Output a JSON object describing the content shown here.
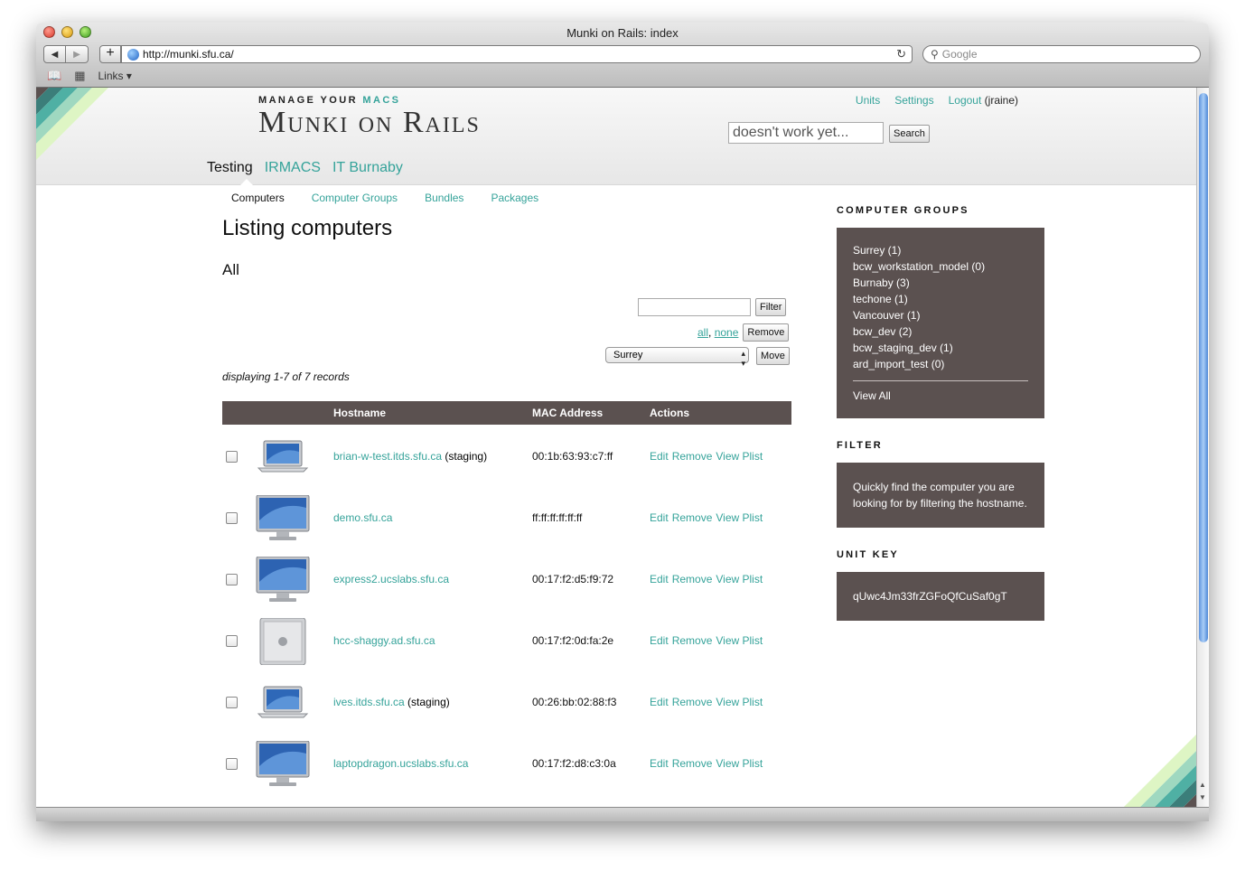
{
  "browser": {
    "window_title": "Munki on Rails: index",
    "url": "http://munki.sfu.ca/",
    "search_placeholder": "Google",
    "bookmarks_label": "Links"
  },
  "header": {
    "tagline_prefix": "MANAGE YOUR",
    "tagline_accent": "MACS",
    "logo": "Munki on Rails",
    "links": {
      "units": "Units",
      "settings": "Settings",
      "logout": "Logout",
      "user": "(jraine)"
    },
    "search_value": "doesn't work yet...",
    "search_button": "Search",
    "unit_tabs": [
      {
        "label": "Testing",
        "active": true
      },
      {
        "label": "IRMACS",
        "active": false
      },
      {
        "label": "IT Burnaby",
        "active": false
      }
    ]
  },
  "subnav": {
    "computers": "Computers",
    "computer_groups": "Computer Groups",
    "bundles": "Bundles",
    "packages": "Packages"
  },
  "main": {
    "title": "Listing computers",
    "subtitle": "All",
    "filter_button": "Filter",
    "select_all": "all",
    "select_none": "none",
    "remove_button": "Remove",
    "group_select": "Surrey",
    "move_button": "Move",
    "records": "displaying 1-7 of 7 records"
  },
  "table": {
    "columns": {
      "hostname": "Hostname",
      "mac": "MAC Address",
      "actions": "Actions"
    },
    "action_labels": {
      "edit": "Edit",
      "remove": "Remove",
      "view": "View Plist"
    },
    "rows": [
      {
        "host": "brian-w-test.itds.sfu.ca",
        "note": "(staging)",
        "mac": "00:1b:63:93:c7:ff",
        "icon": "macbook-icon"
      },
      {
        "host": "demo.sfu.ca",
        "note": "",
        "mac": "ff:ff:ff:ff:ff:ff",
        "icon": "imac-icon"
      },
      {
        "host": "express2.ucslabs.sfu.ca",
        "note": "",
        "mac": "00:17:f2:d5:f9:72",
        "icon": "imac-icon"
      },
      {
        "host": "hcc-shaggy.ad.sfu.ca",
        "note": "",
        "mac": "00:17:f2:0d:fa:2e",
        "icon": "mac-pro-icon"
      },
      {
        "host": "ives.itds.sfu.ca",
        "note": "(staging)",
        "mac": "00:26:bb:02:88:f3",
        "icon": "macbook-icon"
      },
      {
        "host": "laptopdragon.ucslabs.sfu.ca",
        "note": "",
        "mac": "00:17:f2:d8:c3:0a",
        "icon": "imac-icon"
      }
    ]
  },
  "sidebar": {
    "groups_heading": "COMPUTER GROUPS",
    "groups": [
      "Surrey (1)",
      "bcw_workstation_model (0)",
      "Burnaby (3)",
      "techone (1)",
      "Vancouver (1)",
      "bcw_dev (2)",
      "bcw_staging_dev (1)",
      "ard_import_test (0)"
    ],
    "view_all": "View All",
    "filter_heading": "FILTER",
    "filter_text": "Quickly find the computer you are looking for by filtering the hostname.",
    "unit_key_heading": "UNIT KEY",
    "unit_key": "qUwc4Jm33frZGFoQfCuSaf0gT"
  },
  "colors": {
    "accent": "#35a39a",
    "panel": "#5b5150"
  }
}
